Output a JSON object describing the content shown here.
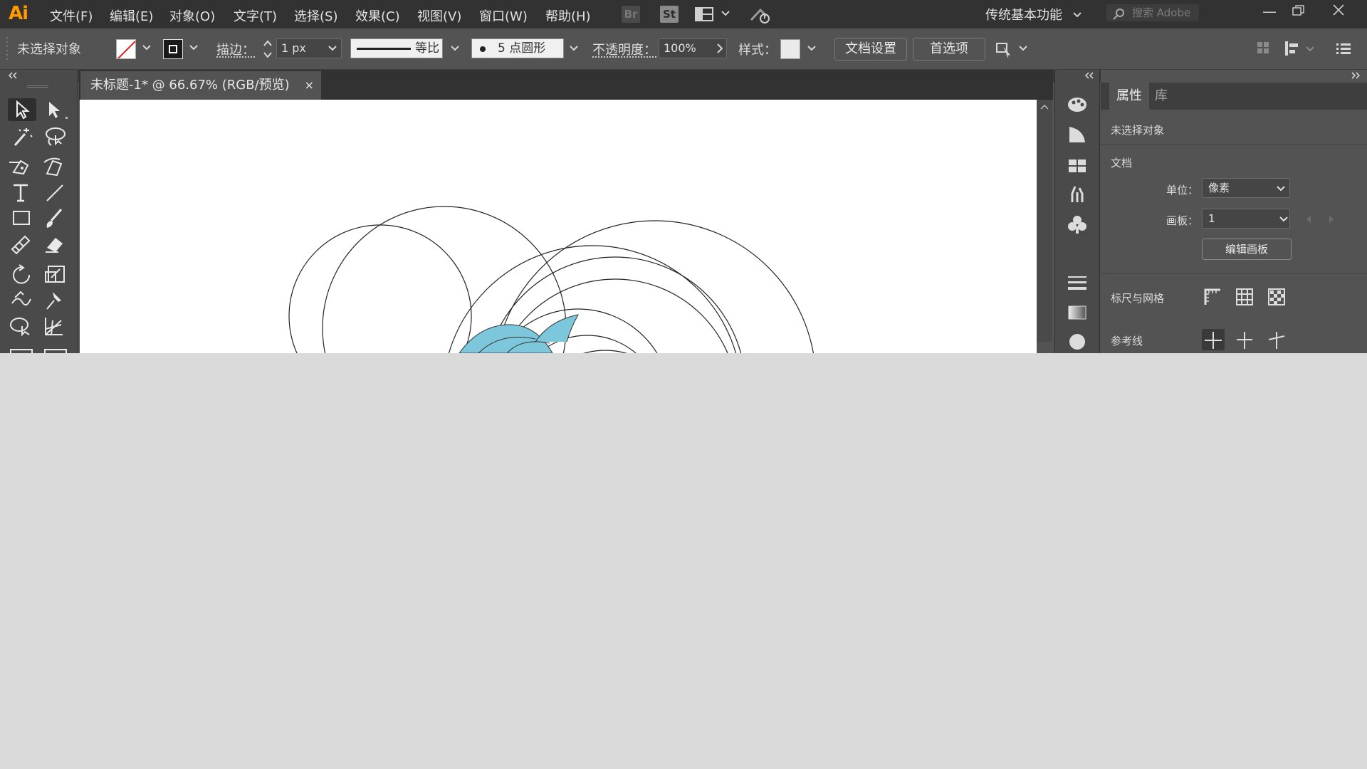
{
  "app": {
    "logo": "Ai"
  },
  "menu": [
    "文件(F)",
    "编辑(E)",
    "对象(O)",
    "文字(T)",
    "选择(S)",
    "效果(C)",
    "视图(V)",
    "窗口(W)",
    "帮助(H)"
  ],
  "menubar_icons": {
    "bridge": "Br",
    "stock": "St"
  },
  "workspace": "传统基本功能",
  "search_placeholder": "搜索 Adobe",
  "control": {
    "selection_status": "未选择对象",
    "stroke_label": "描边：",
    "stroke_weight": "1 px",
    "stroke_profile": "等比",
    "brush": "5 点圆形",
    "opacity_label": "不透明度：",
    "opacity_value": "100%",
    "style_label": "样式：",
    "doc_setup": "文档设置",
    "preferences": "首选项"
  },
  "document_tab": {
    "title": "未标题-1* @ 66.67% (RGB/预览)",
    "close": "×"
  },
  "properties": {
    "tabs": [
      "属性",
      "库"
    ],
    "no_selection": "未选择对象",
    "document_section": "文档",
    "unit_label": "单位：",
    "unit_value": "像素",
    "artboard_label": "画板：",
    "artboard_value": "1",
    "edit_artboards": "编辑画板",
    "rulers_grids": "标尺与网格",
    "guides": "参考线"
  },
  "colors": {
    "app_bg": "#535353",
    "menubar": "#323232",
    "accent_logo": "#ff9a00",
    "artwork_fill": "#7cc7dc",
    "outside_bg": "#dadada"
  }
}
